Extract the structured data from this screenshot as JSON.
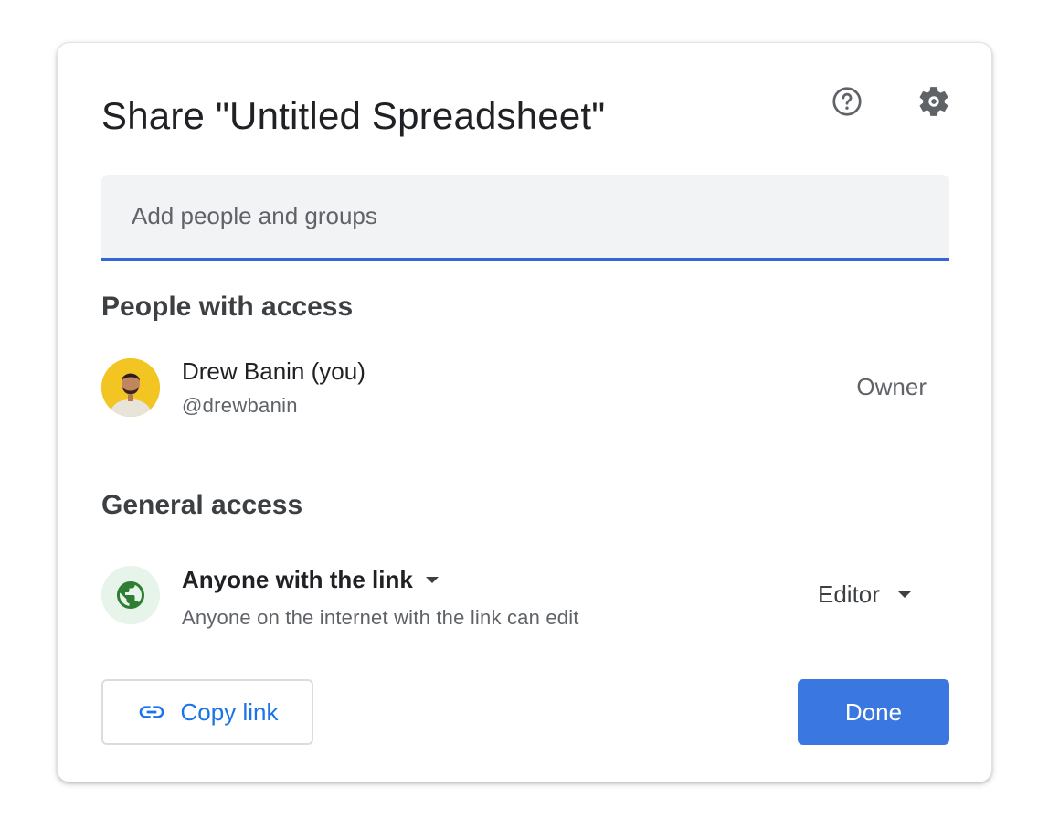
{
  "dialog": {
    "title": "Share \"Untitled Spreadsheet\"",
    "help_icon": "help-circle-icon",
    "settings_icon": "gear-icon"
  },
  "add_people": {
    "placeholder": "Add people and groups",
    "value": ""
  },
  "people_with_access": {
    "heading": "People with access",
    "people": [
      {
        "name": "Drew Banin (you)",
        "handle": "@drewbanin",
        "role": "Owner"
      }
    ]
  },
  "general_access": {
    "heading": "General access",
    "icon": "globe-icon",
    "scope": "Anyone with the link",
    "description": "Anyone on the internet with the link can edit",
    "role": "Editor"
  },
  "footer": {
    "copy_link_label": "Copy link",
    "copy_link_icon": "link-icon",
    "done_label": "Done"
  },
  "colors": {
    "accent_blue": "#1a73e8",
    "done_button": "#3b77e0",
    "field_underline": "#3367d6",
    "globe_bg": "#e6f4ea",
    "globe_fg": "#2e7d32",
    "avatar_bg": "#f2c522"
  }
}
